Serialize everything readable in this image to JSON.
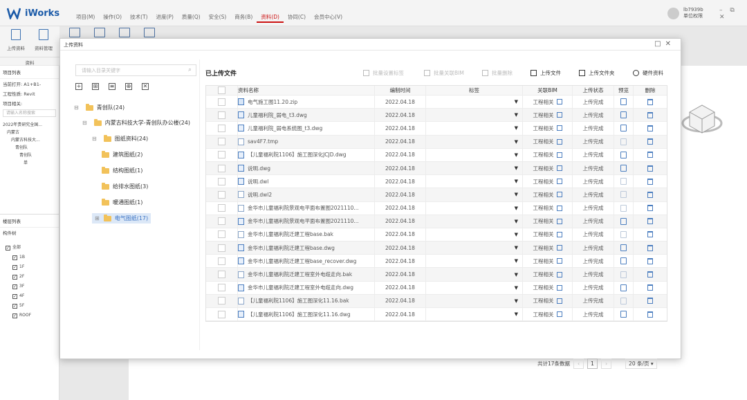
{
  "app": {
    "name": "iWorks",
    "user_name": "lb7939b",
    "user_role": "单位权限"
  },
  "menu": [
    "项目(M)",
    "操作(O)",
    "技术(T)",
    "进度(P)",
    "质量(Q)",
    "安全(S)",
    "商务(B)",
    "资料(D)",
    "协同(C)",
    "会员中心(V)"
  ],
  "menu_active": "资料(D)",
  "toolbar": {
    "upload_label": "上传资料",
    "manage_label": "资料管理",
    "group_label": "资料"
  },
  "left": {
    "project_list_title": "项目列表",
    "current_open_label": "当前打开:",
    "current_open_value": "A1+B1-",
    "project_type_label": "工程性质:",
    "project_type_value": "Revit",
    "project_related_label": "项目相关:",
    "search_placeholder": "请输入名称搜索",
    "tree": [
      "2022年贵研究全国...",
      "内蒙古",
      "内蒙古科技大...",
      "青创队",
      "青创队",
      "单"
    ],
    "floor_title": "楼层列表",
    "component_title": "构件树",
    "floors": [
      "全部",
      "1B",
      "1F",
      "2F",
      "3F",
      "4F",
      "5F",
      "ROOF"
    ]
  },
  "dialog": {
    "title": "上传资料",
    "search_placeholder": "请输入目录关键字",
    "tree": {
      "root": "青创队(24)",
      "level1": "内蒙古科技大学-青创队办公楼(24)",
      "level2": "图纸资料(24)",
      "children": [
        "建筑图纸(2)",
        "结构图纸(1)",
        "给排水图纸(3)",
        "暖通图纸(1)",
        "电气图纸(17)"
      ]
    },
    "section_title": "已上传文件",
    "actions": {
      "batch_tag": "批量设置标签",
      "batch_bim": "批量关联BIM",
      "batch_delete": "批量删除",
      "upload_file": "上传文件",
      "upload_folder": "上传文件夹",
      "hardware": "硬件资料"
    },
    "columns": {
      "name": "资料名称",
      "date": "编制时间",
      "tag": "标签",
      "bim": "关联BIM",
      "status": "上传状态",
      "preview": "预览",
      "delete": "删除"
    },
    "rows": [
      {
        "name": "电气施工图11.20.zip",
        "date": "2022.04.18",
        "rel": "工程相关",
        "status": "上传完成",
        "icon": "zip",
        "pv": true
      },
      {
        "name": "儿童福利院_弱电_t3.dwg",
        "date": "2022.04.18",
        "rel": "工程相关",
        "status": "上传完成",
        "icon": "dwg",
        "pv": true
      },
      {
        "name": "儿童福利院_弱电系统图_t3.dwg",
        "date": "2022.04.18",
        "rel": "工程相关",
        "status": "上传完成",
        "icon": "dwg",
        "pv": true
      },
      {
        "name": "sav4F7.tmp",
        "date": "2022.04.18",
        "rel": "工程相关",
        "status": "上传完成",
        "icon": "plain",
        "pv": false
      },
      {
        "name": "【儿童福利院1106】施工图深化JCJD.dwg",
        "date": "2022.04.18",
        "rel": "工程相关",
        "status": "上传完成",
        "icon": "dwg",
        "pv": true
      },
      {
        "name": "说明.dwg",
        "date": "2022.04.18",
        "rel": "工程相关",
        "status": "上传完成",
        "icon": "dwg",
        "pv": true
      },
      {
        "name": "说明.dwl",
        "date": "2022.04.18",
        "rel": "工程相关",
        "status": "上传完成",
        "icon": "dwg",
        "pv": false
      },
      {
        "name": "说明.dwl2",
        "date": "2022.04.18",
        "rel": "工程相关",
        "status": "上传完成",
        "icon": "plain",
        "pv": false
      },
      {
        "name": "金华市儿童福利院景观电平面布置图2021110...",
        "date": "2022.04.18",
        "rel": "工程相关",
        "status": "上传完成",
        "icon": "plain",
        "pv": false
      },
      {
        "name": "金华市儿童福利院景观电平面布置图2021110...",
        "date": "2022.04.18",
        "rel": "工程相关",
        "status": "上传完成",
        "icon": "dwg",
        "pv": true
      },
      {
        "name": "金华市儿童福利院迁建工程base.bak",
        "date": "2022.04.18",
        "rel": "工程相关",
        "status": "上传完成",
        "icon": "plain",
        "pv": false
      },
      {
        "name": "金华市儿童福利院迁建工程base.dwg",
        "date": "2022.04.18",
        "rel": "工程相关",
        "status": "上传完成",
        "icon": "dwg",
        "pv": true
      },
      {
        "name": "金华市儿童福利院迁建工程base_recover.dwg",
        "date": "2022.04.18",
        "rel": "工程相关",
        "status": "上传完成",
        "icon": "dwg",
        "pv": true
      },
      {
        "name": "金华市儿童福利院迁建工程室外电缆走向.bak",
        "date": "2022.04.18",
        "rel": "工程相关",
        "status": "上传完成",
        "icon": "plain",
        "pv": false
      },
      {
        "name": "金华市儿童福利院迁建工程室外电缆走向.dwg",
        "date": "2022.04.18",
        "rel": "工程相关",
        "status": "上传完成",
        "icon": "dwg",
        "pv": true
      },
      {
        "name": "【儿童福利院1106】施工图深化11.16.bak",
        "date": "2022.04.18",
        "rel": "工程相关",
        "status": "上传完成",
        "icon": "plain",
        "pv": false
      },
      {
        "name": "【儿童福利院1106】施工图深化11.16.dwg",
        "date": "2022.04.18",
        "rel": "工程相关",
        "status": "上传完成",
        "icon": "dwg",
        "pv": true
      }
    ],
    "pager": {
      "total": "共计17条数据",
      "page": "1",
      "size": "20 条/页"
    }
  }
}
